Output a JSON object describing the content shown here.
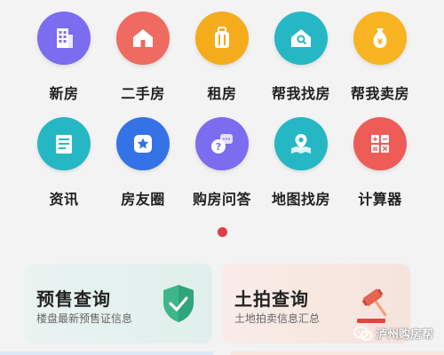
{
  "colors": {
    "background": "#f3f3f3",
    "page_indicator": "#e03c46",
    "presale_card_bg": "#e4f1ee",
    "land_card_bg": "#f8e9e3"
  },
  "menu": {
    "items": [
      {
        "label": "新房",
        "icon": "building-icon",
        "color": "#7b6cf0"
      },
      {
        "label": "二手房",
        "icon": "house-icon",
        "color": "#ef6a60"
      },
      {
        "label": "租房",
        "icon": "luggage-icon",
        "color": "#f5ac1c"
      },
      {
        "label": "帮我找房",
        "icon": "house-search-icon",
        "color": "#25b8c4"
      },
      {
        "label": "帮我卖房",
        "icon": "money-bag-icon",
        "color": "#f7b322"
      },
      {
        "label": "资讯",
        "icon": "news-icon",
        "color": "#25b8c4"
      },
      {
        "label": "房友圈",
        "icon": "star-badge-icon",
        "color": "#3572e6"
      },
      {
        "label": "购房问答",
        "icon": "chat-question-icon",
        "color": "#7b6cf0"
      },
      {
        "label": "地图找房",
        "icon": "map-pin-icon",
        "color": "#25b8c4"
      },
      {
        "label": "计算器",
        "icon": "calculator-icon",
        "color": "#ee5c58"
      }
    ]
  },
  "cards": {
    "presale": {
      "title": "预售查询",
      "subtitle": "楼盘最新预售证信息",
      "icon": "shield-check-icon"
    },
    "land": {
      "title": "土拍查询",
      "subtitle": "土地拍卖信息汇总",
      "icon": "gavel-icon"
    }
  },
  "watermark": {
    "text": "泸州购房帮",
    "icon": "wechat-icon"
  }
}
